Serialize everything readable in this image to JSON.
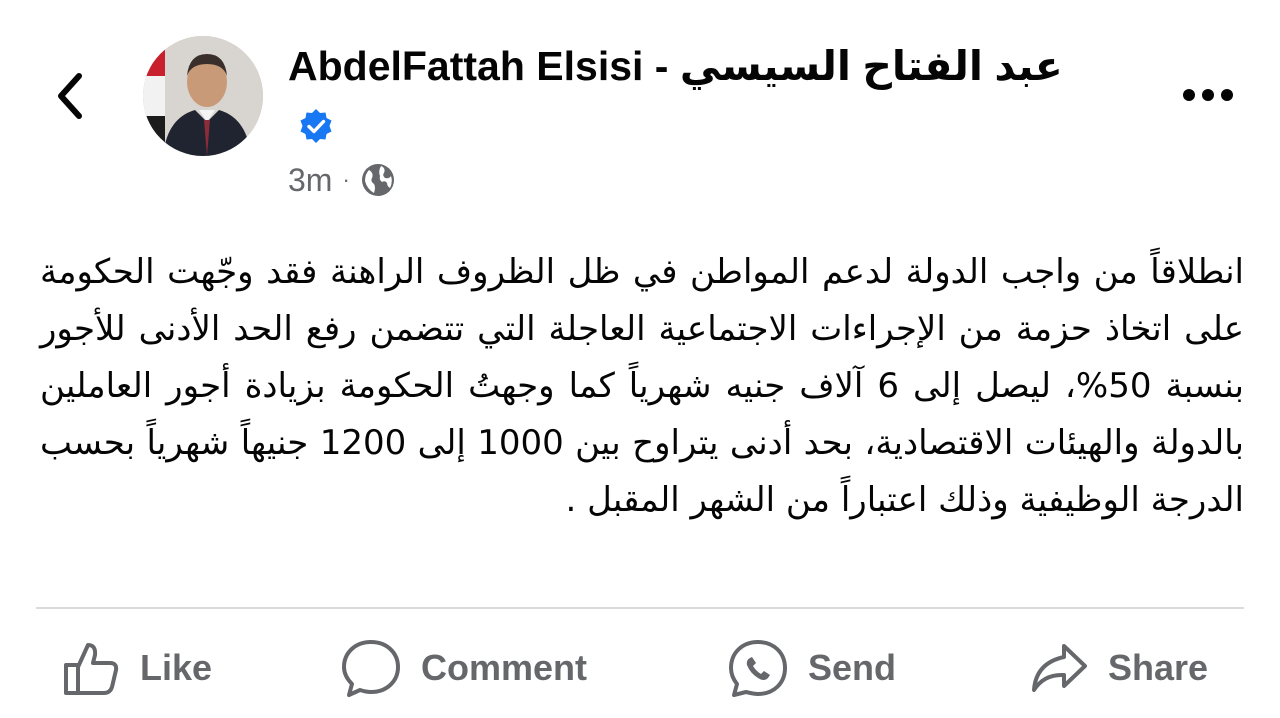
{
  "header": {
    "author_name": "AbdelFattah Elsisi - عبد  الفتاح  السيسي",
    "timestamp": "3m",
    "separator": "·",
    "audience_icon": "globe-icon",
    "verified_icon": "verified-badge-icon",
    "back_icon": "chevron-left-icon",
    "more_icon": "more-dots-icon"
  },
  "post": {
    "text": "انطلاقاً من واجب الدولة لدعم المواطن في ظل الظروف الراهنة فقد وجّهت الحكومة على اتخاذ حزمة من الإجراءات الاجتماعية العاجلة التي تتضمن رفع الحد الأدنى للأجور بنسبة 50%، ليصل إلى 6 آلاف جنيه شهرياً كما وجهتُ الحكومة بزيادة أجور العاملين بالدولة والهيئات الاقتصادية، بحد أدنى يتراوح بين 1000 إلى 1200 جنيهاً شهرياً بحسب الدرجة الوظيفية وذلك اعتباراً من الشهر المقبل ."
  },
  "actions": {
    "like": {
      "label": "Like",
      "icon": "thumbs-up-icon"
    },
    "comment": {
      "label": "Comment",
      "icon": "comment-bubble-icon"
    },
    "send": {
      "label": "Send",
      "icon": "messenger-icon"
    },
    "share": {
      "label": "Share",
      "icon": "share-arrow-icon"
    }
  },
  "colors": {
    "text": "#050505",
    "secondary": "#65676b",
    "verified_blue": "#1877f2",
    "divider": "#d9dadd"
  }
}
